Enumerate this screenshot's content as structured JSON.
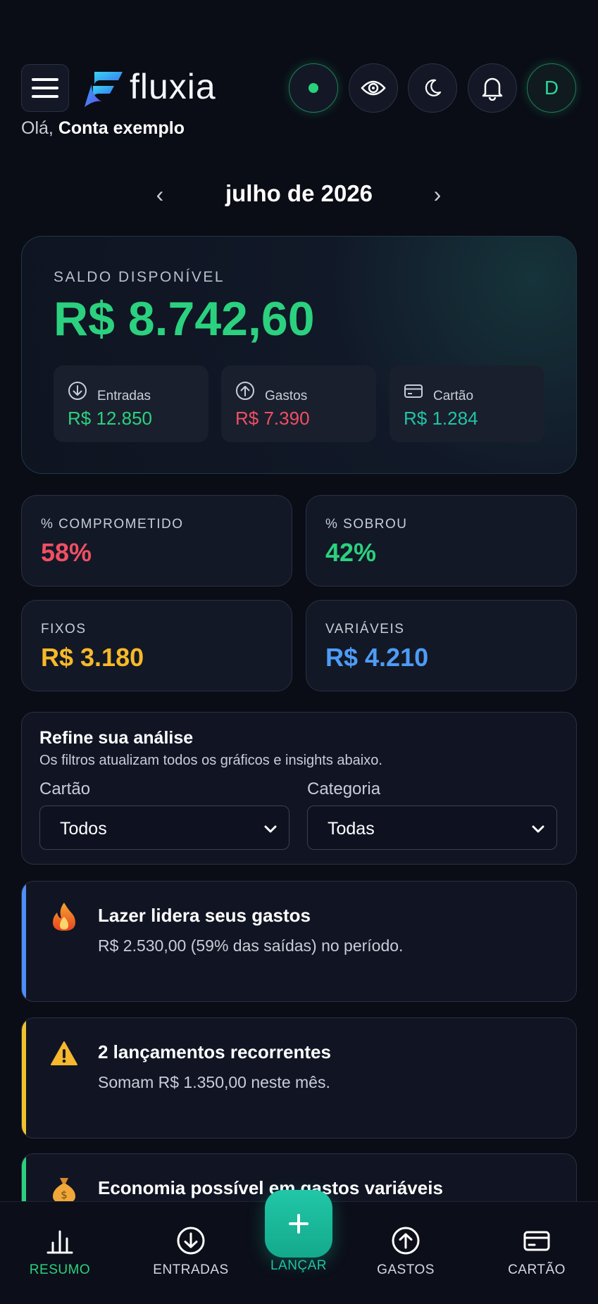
{
  "app": {
    "name": "fluxia"
  },
  "header": {
    "greeting_prefix": "Olá,",
    "user_name": "Conta exemplo",
    "avatar_initial": "D",
    "icons": [
      "menu-icon",
      "status-dot-icon",
      "eye-icon",
      "moon-icon",
      "bell-icon"
    ]
  },
  "period": {
    "label": "julho de 2026",
    "prev": "‹",
    "next": "›"
  },
  "balance": {
    "label": "SALDO DISPONÍVEL",
    "value": "R$ 8.742,60",
    "color": "#2bd17e",
    "items": [
      {
        "label": "Entradas",
        "value": "R$ 12.850",
        "color": "#2bd17e",
        "icon": "arrow-down-circle-icon"
      },
      {
        "label": "Gastos",
        "value": "R$ 7.390",
        "color": "#f04f63",
        "icon": "arrow-up-circle-icon"
      },
      {
        "label": "Cartão",
        "value": "R$ 1.284",
        "color": "#22c3a6",
        "icon": "credit-card-icon"
      }
    ]
  },
  "stats": [
    {
      "label": "% COMPROMETIDO",
      "value": "58%",
      "color": "#f04f63"
    },
    {
      "label": "% SOBROU",
      "value": "42%",
      "color": "#2bd17e"
    },
    {
      "label": "FIXOS",
      "value": "R$ 3.180",
      "color": "#f7b928"
    },
    {
      "label": "VARIÁVEIS",
      "value": "R$ 4.210",
      "color": "#4d9cf7"
    }
  ],
  "filters": {
    "title": "Refine sua análise",
    "subtitle": "Os filtros atualizam todos os gráficos e insights abaixo.",
    "card_label": "Cartão",
    "card_value": "Todos",
    "category_label": "Categoria",
    "category_value": "Todas"
  },
  "insights": [
    {
      "icon": "fire-icon",
      "title": "Lazer lidera seus gastos",
      "text": "R$ 2.530,00 (59% das saídas) no período.",
      "accent": "#4d8ff7"
    },
    {
      "icon": "warning-icon",
      "title": "2 lançamentos recorrentes",
      "text": "Somam R$ 1.350,00 neste mês.",
      "accent": "#f2c12e"
    },
    {
      "icon": "money-bag-icon",
      "title": "Economia possível em gastos variáveis",
      "text": "",
      "accent": "#2bd17e"
    }
  ],
  "bottom_nav": {
    "items": [
      {
        "label": "RESUMO",
        "icon": "bar-chart-icon",
        "active": true
      },
      {
        "label": "ENTRADAS",
        "icon": "arrow-down-circle-icon"
      },
      {
        "label": "LANÇAR",
        "icon": "plus-icon"
      },
      {
        "label": "GASTOS",
        "icon": "arrow-up-circle-icon"
      },
      {
        "label": "CARTÃO",
        "icon": "credit-card-icon"
      }
    ],
    "fab_symbol": "+"
  }
}
